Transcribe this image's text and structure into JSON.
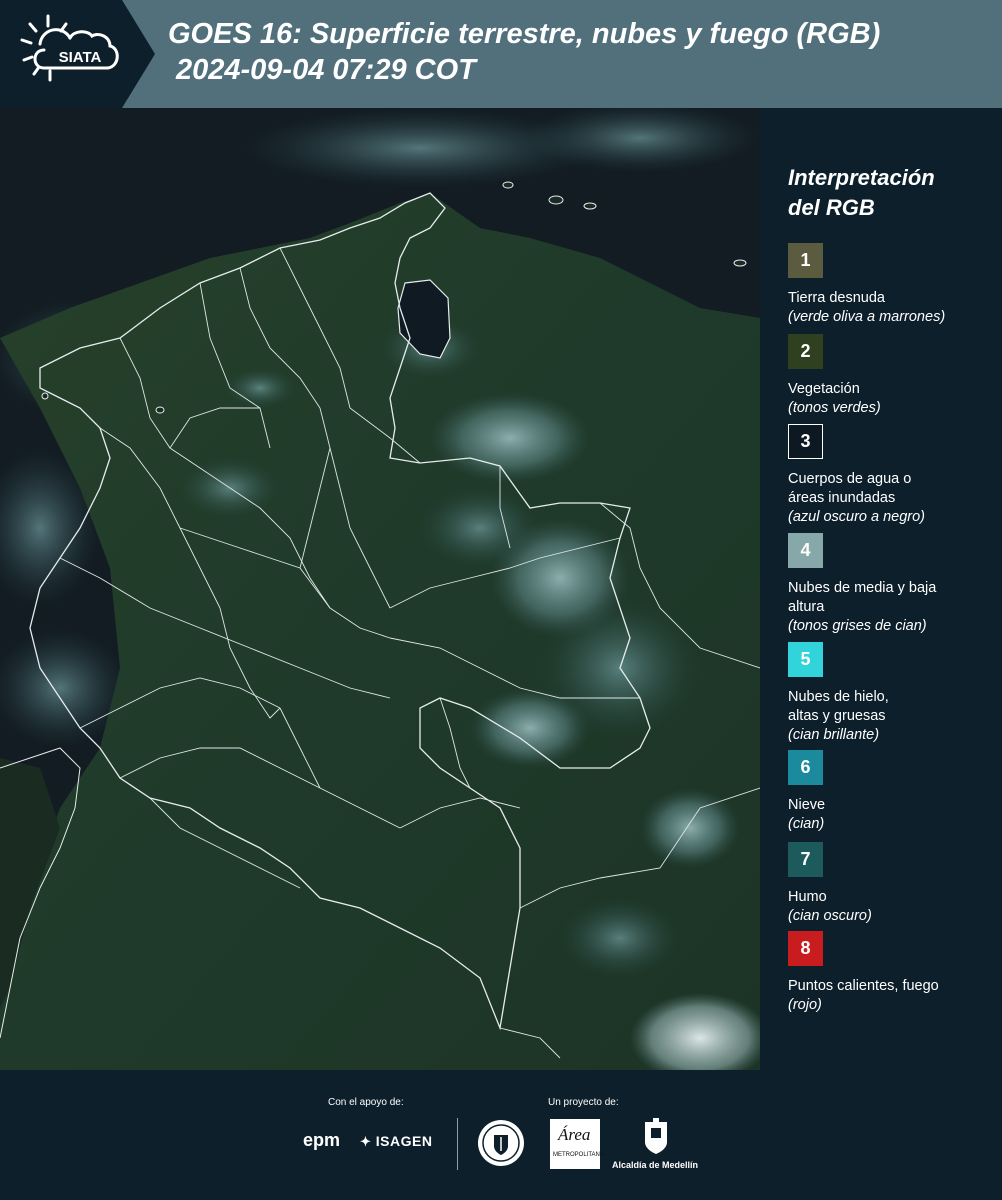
{
  "header": {
    "logo_text": "SIATA",
    "title_line1": "GOES 16: Superficie terrestre, nubes y fuego (RGB)",
    "title_line2": "2024-09-04 07:29 COT"
  },
  "legend": {
    "title_line1": "Interpretación",
    "title_line2": "del RGB",
    "items": [
      {
        "number": "1",
        "color": "#5b5b40",
        "label": "Tierra desnuda",
        "hint": "(verde oliva a marrones)"
      },
      {
        "number": "2",
        "color": "#2e4020",
        "label": "Vegetación",
        "hint": "(tonos verdes)"
      },
      {
        "number": "3",
        "color": "#0c1822",
        "label": "Cuerpos de agua o áreas inundadas",
        "hint": "(azul oscuro a negro)"
      },
      {
        "number": "4",
        "color": "#86a8a8",
        "label": "Nubes de media y baja altura",
        "hint": "(tonos grises de cian)"
      },
      {
        "number": "5",
        "color": "#31d4da",
        "label": "Nubes de hielo, altas y gruesas",
        "hint": "(cian brillante)"
      },
      {
        "number": "6",
        "color": "#1b8a9c",
        "label": "Nieve",
        "hint": "(cian)"
      },
      {
        "number": "7",
        "color": "#1d5a5c",
        "label": "Humo",
        "hint": "(cian oscuro)"
      },
      {
        "number": "8",
        "color": "#c81c1e",
        "label": "Puntos calientes, fuego",
        "hint": "(rojo)"
      }
    ]
  },
  "footer": {
    "support_label": "Con el apoyo de:",
    "project_label": "Un proyecto de:",
    "sponsor1": "epm",
    "sponsor2": "ISAGEN",
    "partner1": "Área",
    "partner1_sub": "METROPOLITANA",
    "partner2": "Alcaldía de Medellín"
  }
}
